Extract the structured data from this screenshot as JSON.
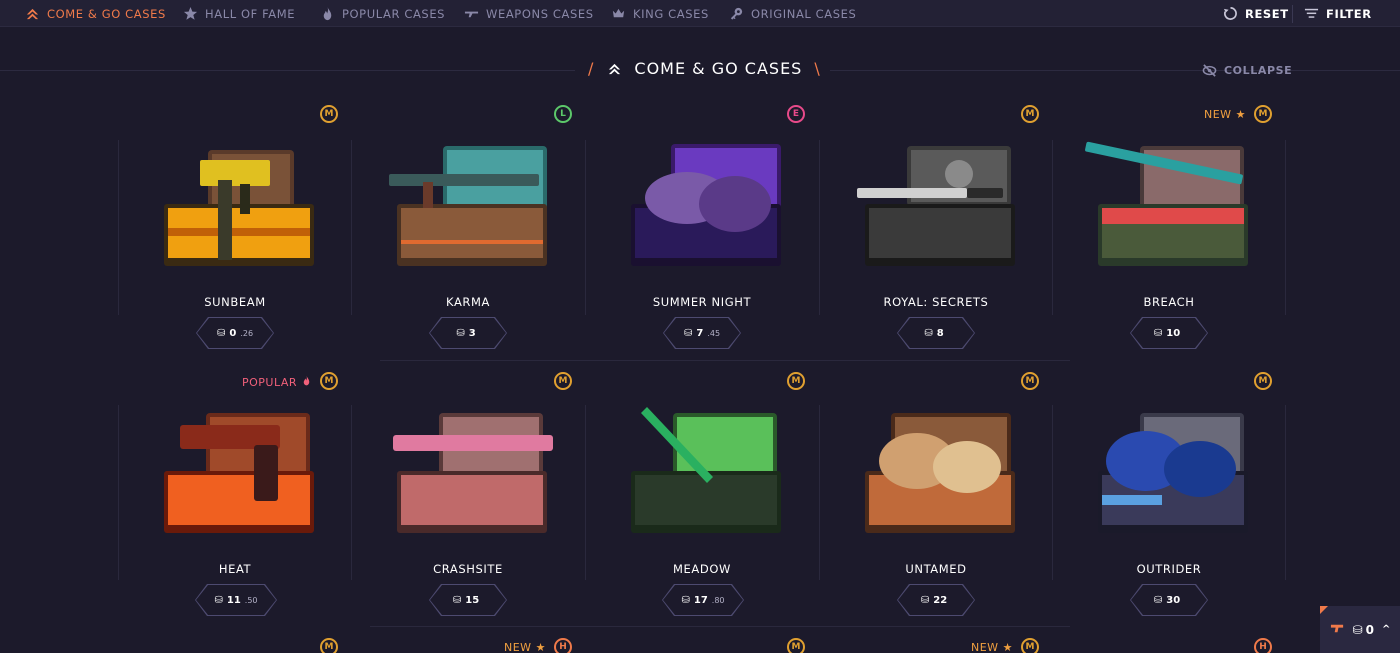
{
  "nav": {
    "items": [
      {
        "label": "COME & GO CASES",
        "icon": "chevrons-up-icon",
        "active": true
      },
      {
        "label": "HALL OF FAME",
        "icon": "star-icon",
        "active": false
      },
      {
        "label": "POPULAR CASES",
        "icon": "flame-icon",
        "active": false
      },
      {
        "label": "WEAPONS CASES",
        "icon": "rifle-icon",
        "active": false
      },
      {
        "label": "KING CASES",
        "icon": "crown-icon",
        "active": false
      },
      {
        "label": "ORIGINAL CASES",
        "icon": "key-icon",
        "active": false
      }
    ],
    "reset_label": "RESET",
    "filter_label": "FILTER"
  },
  "section": {
    "title": "COME & GO CASES",
    "collapse_label": "COLLAPSE"
  },
  "tags": {
    "new": "NEW",
    "popular": "POPULAR"
  },
  "cases": [
    {
      "name": "SUNBEAM",
      "price_main": "0",
      "price_cents": ".26",
      "badge": "M",
      "tag": null
    },
    {
      "name": "KARMA",
      "price_main": "3",
      "price_cents": "",
      "badge": "L",
      "tag": null
    },
    {
      "name": "SUMMER NIGHT",
      "price_main": "7",
      "price_cents": ".45",
      "badge": "E",
      "tag": null
    },
    {
      "name": "ROYAL: SECRETS",
      "price_main": "8",
      "price_cents": "",
      "badge": "M",
      "tag": null
    },
    {
      "name": "BREACH",
      "price_main": "10",
      "price_cents": "",
      "badge": "M",
      "tag": "NEW"
    },
    {
      "name": "HEAT",
      "price_main": "11",
      "price_cents": ".50",
      "badge": "M",
      "tag": "POPULAR"
    },
    {
      "name": "CRASHSITE",
      "price_main": "15",
      "price_cents": "",
      "badge": "M",
      "tag": null
    },
    {
      "name": "MEADOW",
      "price_main": "17",
      "price_cents": ".80",
      "badge": "M",
      "tag": null
    },
    {
      "name": "UNTAMED",
      "price_main": "22",
      "price_cents": "",
      "badge": "M",
      "tag": null
    },
    {
      "name": "OUTRIDER",
      "price_main": "30",
      "price_cents": "",
      "badge": "M",
      "tag": null
    }
  ],
  "next_row_badges": [
    {
      "badge": "M",
      "tag": null
    },
    {
      "badge": "H",
      "tag": "NEW"
    },
    {
      "badge": "M",
      "tag": null
    },
    {
      "badge": "M",
      "tag": "NEW"
    },
    {
      "badge": "H",
      "tag": null
    }
  ],
  "cart": {
    "count": "0"
  },
  "colors": {
    "accent": "#f07a4a",
    "badge_m": "#e0a030",
    "badge_l": "#5cc86a",
    "badge_e": "#e84a8a",
    "badge_h": "#f07a4a",
    "popular": "#f0607a",
    "new": "#f0a040"
  }
}
